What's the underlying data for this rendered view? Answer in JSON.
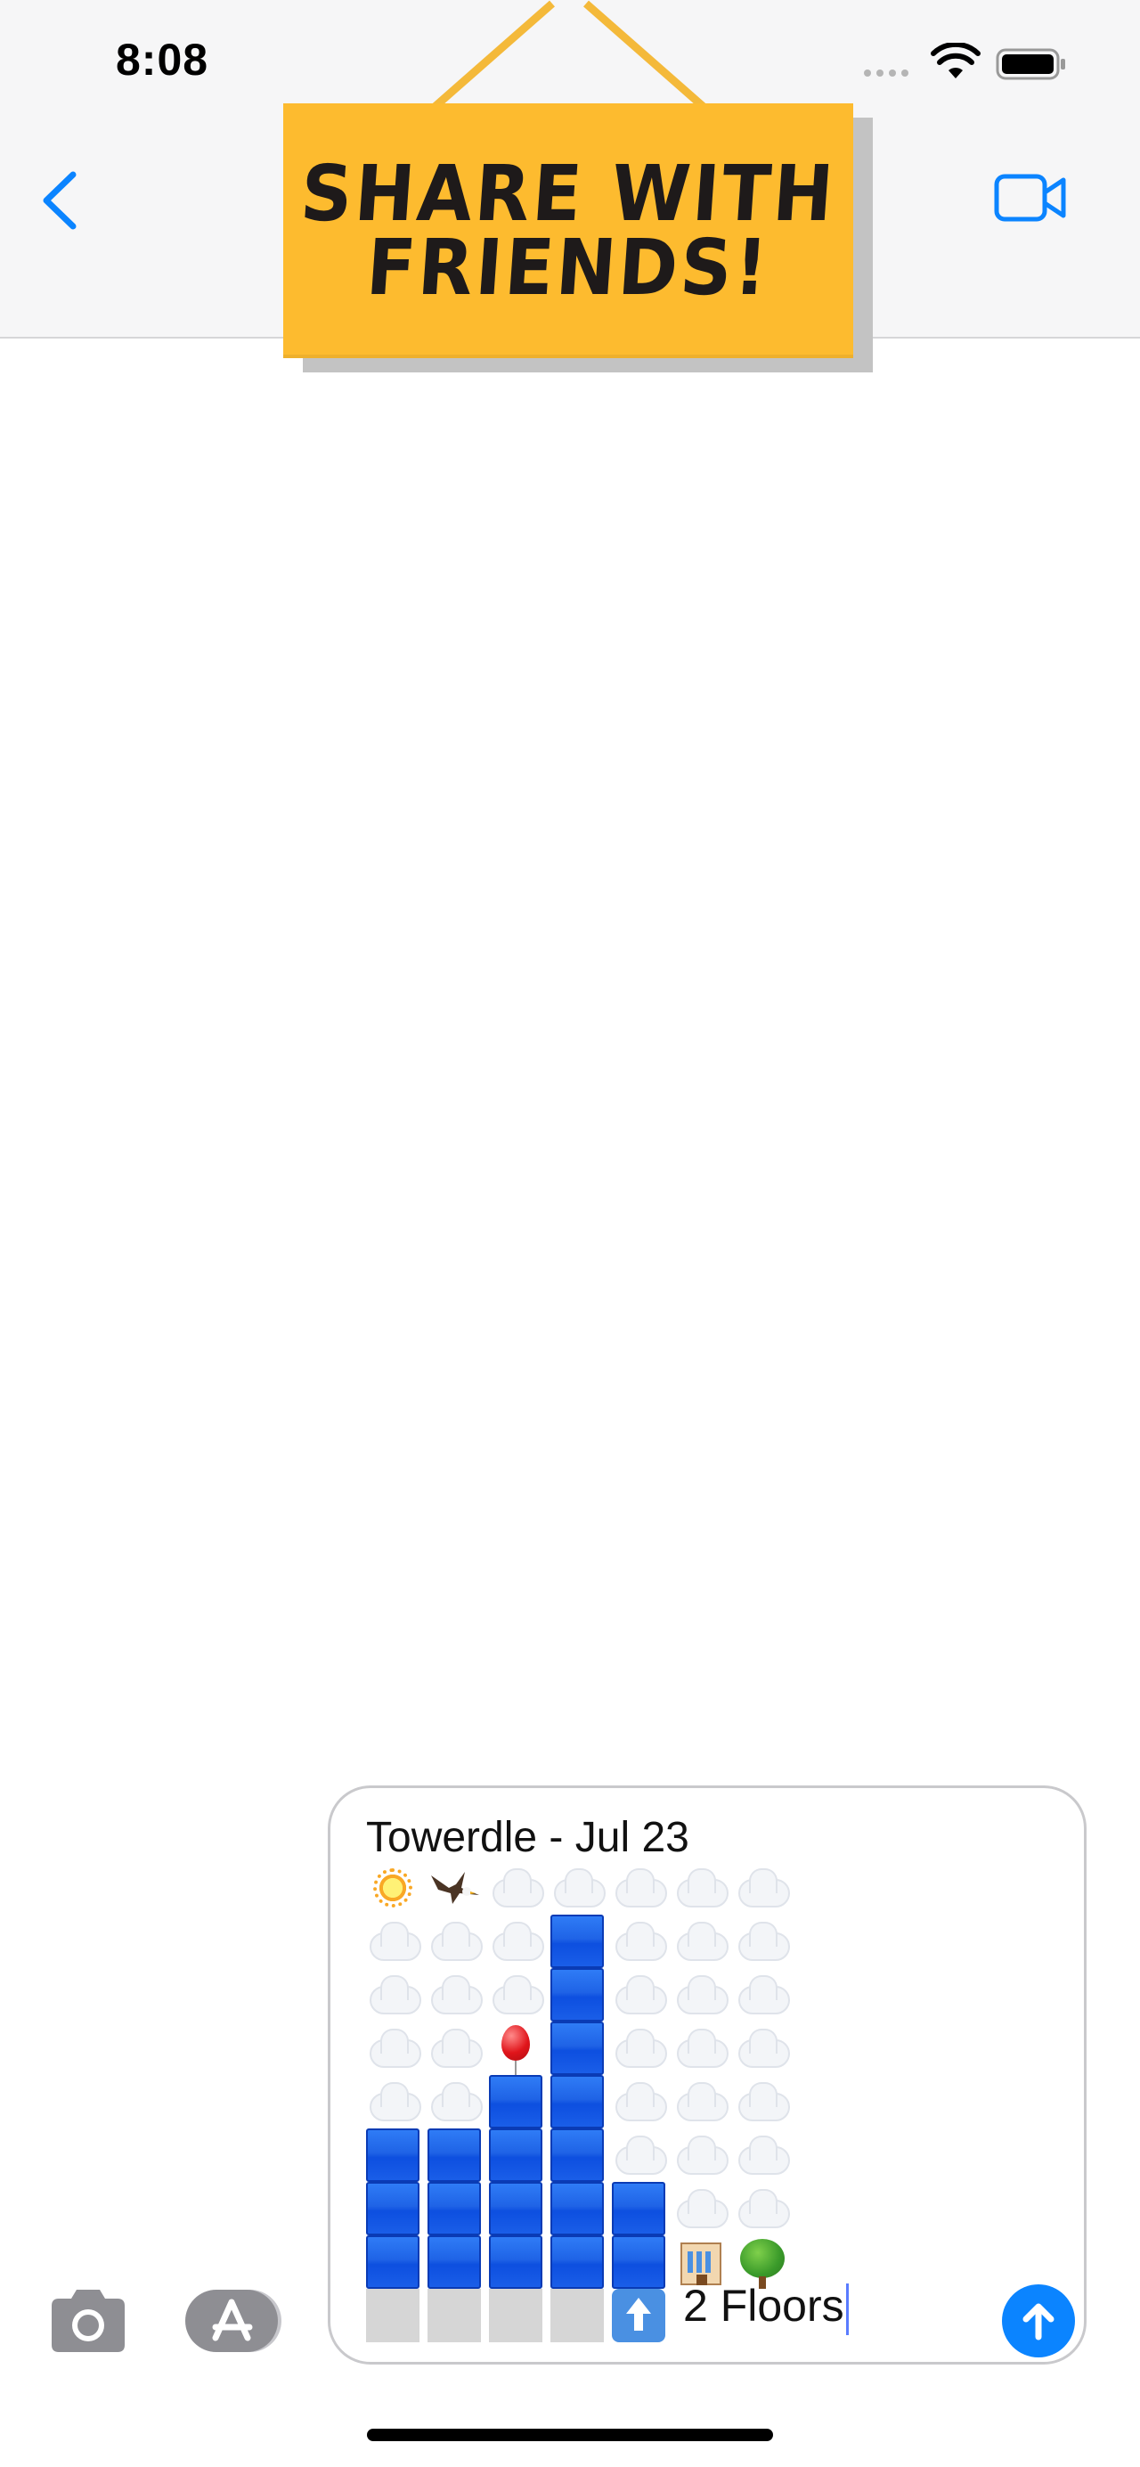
{
  "status_bar": {
    "time": "8:08"
  },
  "header": {
    "back_icon": "chevron-left-icon",
    "video_icon": "video-camera-icon"
  },
  "banner": {
    "line1": "SHARE WITH",
    "line2": "FRIENDS!"
  },
  "colors": {
    "accent": "#0B84FF",
    "banner": "#FDBB2F",
    "block": "#1A5EE8"
  },
  "message": {
    "title": "Towerdle - Jul 23",
    "result_text": "2 Floors",
    "grid": [
      [
        "sun",
        "eagle",
        "cloud",
        "cloud",
        "cloud",
        "cloud",
        "cloud"
      ],
      [
        "cloud",
        "cloud",
        "cloud",
        "block",
        "cloud",
        "cloud",
        "cloud"
      ],
      [
        "cloud",
        "cloud",
        "cloud",
        "block",
        "cloud",
        "cloud",
        "cloud"
      ],
      [
        "cloud",
        "cloud",
        "balloon",
        "block",
        "cloud",
        "cloud",
        "cloud"
      ],
      [
        "cloud",
        "cloud",
        "block",
        "block",
        "cloud",
        "cloud",
        "cloud"
      ],
      [
        "block",
        "block",
        "block",
        "block",
        "cloud",
        "cloud",
        "cloud"
      ],
      [
        "block",
        "block",
        "block",
        "block",
        "block",
        "cloud",
        "cloud"
      ],
      [
        "block",
        "block",
        "block",
        "block",
        "block",
        "building",
        "tree"
      ],
      [
        "ground",
        "ground",
        "ground",
        "ground",
        "up-arrow",
        "",
        ""
      ]
    ]
  },
  "toolbar": {
    "camera_icon": "camera-icon",
    "apps_icon": "app-store-icon",
    "send_icon": "send-arrow-icon"
  }
}
